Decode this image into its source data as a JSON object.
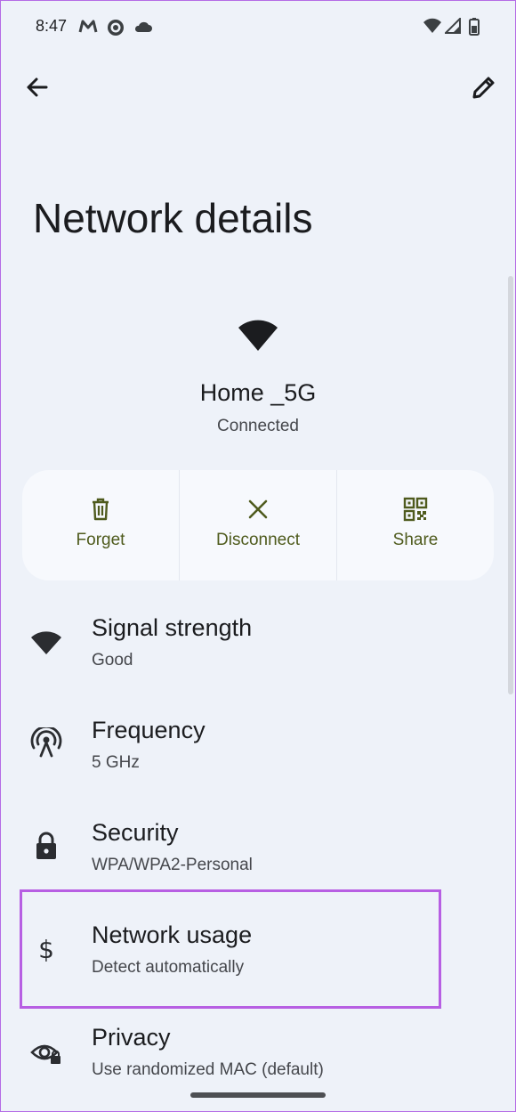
{
  "status_bar": {
    "time": "8:47",
    "left_icons": [
      "gmail-icon",
      "whatsapp-icon",
      "cloud-icon"
    ],
    "right_icons": [
      "wifi-signal-icon",
      "cellular-signal-icon",
      "battery-icon"
    ]
  },
  "page": {
    "title": "Network details"
  },
  "network": {
    "name": "Home _5G",
    "status": "Connected"
  },
  "actions": [
    {
      "label": "Forget",
      "icon": "trash-icon"
    },
    {
      "label": "Disconnect",
      "icon": "close-icon"
    },
    {
      "label": "Share",
      "icon": "qr-code-icon"
    }
  ],
  "items": [
    {
      "title": "Signal strength",
      "subtitle": "Good",
      "icon": "wifi-icon"
    },
    {
      "title": "Frequency",
      "subtitle": "5 GHz",
      "icon": "antenna-icon"
    },
    {
      "title": "Security",
      "subtitle": "WPA/WPA2-Personal",
      "icon": "lock-icon"
    },
    {
      "title": "Network usage",
      "subtitle": "Detect automatically",
      "icon": "dollar-icon"
    },
    {
      "title": "Privacy",
      "subtitle": "Use randomized MAC (default)",
      "icon": "eye-lock-icon"
    }
  ],
  "colors": {
    "background": "#eef2f9",
    "action_accent": "#4f5b1d",
    "highlight": "#b75fe3"
  }
}
